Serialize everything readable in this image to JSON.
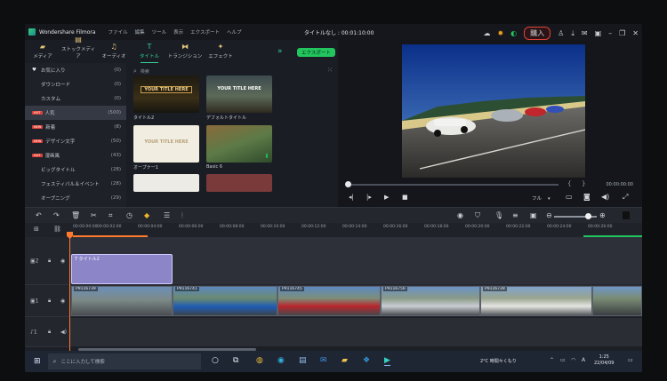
{
  "app": {
    "name": "Wondershare Filmora",
    "menu": [
      "ファイル",
      "編集",
      "ツール",
      "表示",
      "エクスポート",
      "ヘルプ"
    ],
    "project_title": "タイトルなし : 00:01:10:00",
    "buy_label": "購入"
  },
  "asset_tabs": [
    {
      "label": "メディア",
      "icon": "folder-icon"
    },
    {
      "label": "ストックメディア",
      "icon": "stock-media-icon"
    },
    {
      "label": "オーディオ",
      "icon": "music-note-icon"
    },
    {
      "label": "タイトル",
      "icon": "title-t-icon"
    },
    {
      "label": "トランジション",
      "icon": "transition-icon"
    },
    {
      "label": "エフェクト",
      "icon": "effects-icon"
    }
  ],
  "export_label": "エクスポート",
  "sidebar": {
    "items": [
      {
        "label": "お気に入り",
        "count": "(0)",
        "badge": ""
      },
      {
        "label": "ダウンロード",
        "count": "(0)",
        "badge": ""
      },
      {
        "label": "カスタム",
        "count": "(0)",
        "badge": ""
      },
      {
        "label": "人気",
        "count": "(500)",
        "badge": "HOT"
      },
      {
        "label": "新着",
        "count": "(8)",
        "badge": "NEW"
      },
      {
        "label": "デザイン文字",
        "count": "(50)",
        "badge": "NEW"
      },
      {
        "label": "漫画風",
        "count": "(43)",
        "badge": "HOT"
      },
      {
        "label": "ビッグタイトル",
        "count": "(28)",
        "badge": ""
      },
      {
        "label": "フェスティバル＆イベント",
        "count": "(28)",
        "badge": ""
      },
      {
        "label": "オープニング",
        "count": "(29)",
        "badge": ""
      }
    ]
  },
  "search": {
    "placeholder": "検索"
  },
  "thumbnails": [
    {
      "label": "タイトル2",
      "overlay": "YOUR TITLE HERE"
    },
    {
      "label": "デフォルトタイトル",
      "overlay": "YOUR TITLE HERE"
    },
    {
      "label": "オープナー1",
      "overlay": "YOUR TITLE HERE"
    },
    {
      "label": "Basic 6",
      "overlay": ""
    }
  ],
  "preview": {
    "time": "00:00:00:00",
    "quality": "フル"
  },
  "ruler_labels": [
    "00:00:00:00",
    "00:00:02:00",
    "00:00:04:00",
    "00:00:06:00",
    "00:00:08:00",
    "00:00:10:00",
    "00:00:12:00",
    "00:00:14:00",
    "00:00:16:00",
    "00:00:18:00",
    "00:00:20:00",
    "00:00:22:00",
    "00:00:24:00",
    "00:00:26:00"
  ],
  "tracks": {
    "title_clip_label": "タイトル2",
    "video_clips": [
      "P9116739",
      "P9116741",
      "P9116745",
      "P9116756",
      "P9116739"
    ]
  },
  "taskbar": {
    "search_placeholder": "ここに入力して検索",
    "weather": "2°C 時間々くもり",
    "time": "1:25",
    "date": "22/04/09"
  },
  "colors": {
    "accent": "#22c55e",
    "playhead": "#ff7a2e",
    "title_clip": "#8c86c9"
  }
}
